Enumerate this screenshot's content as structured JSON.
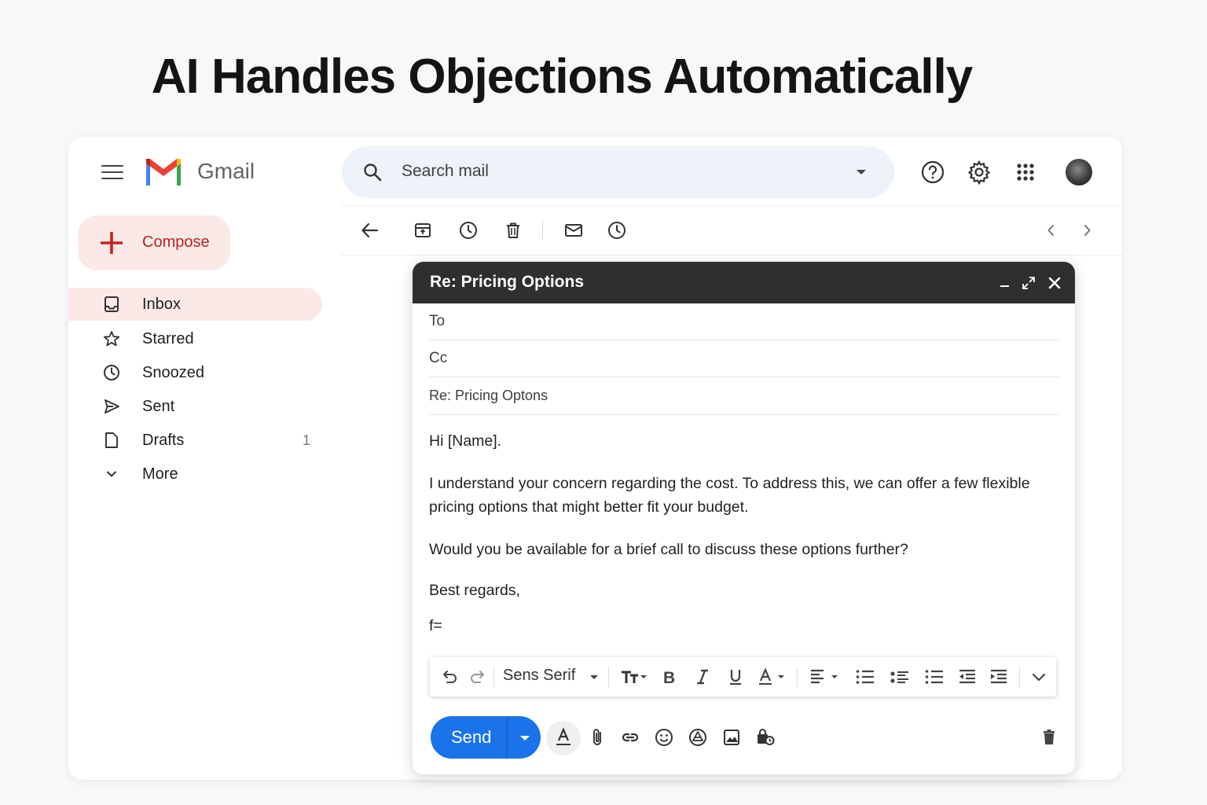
{
  "headline": "AI Handles Objections Automatically",
  "app": {
    "name": "Gmail"
  },
  "search": {
    "placeholder": "Search mail"
  },
  "compose": {
    "label": "Compose"
  },
  "nav": [
    {
      "label": "Inbox",
      "icon": "inbox-icon",
      "active": true
    },
    {
      "label": "Starred",
      "icon": "star-icon"
    },
    {
      "label": "Snoozed",
      "icon": "clock-icon"
    },
    {
      "label": "Sent",
      "icon": "send-icon"
    },
    {
      "label": "Drafts",
      "icon": "draft-icon",
      "count": "1"
    },
    {
      "label": "More",
      "icon": "chevron-down-icon"
    }
  ],
  "reply": {
    "window_title": "Re: Pricing Options",
    "to_label": "To",
    "cc_label": "Cc",
    "subject": "Re:  Pricing Optons",
    "body": {
      "greeting": "Hi [Name].",
      "paragraph1": "I understand your concern regarding the cost. To address this, we can offer a few flexible pricing options that might better fit your budget.",
      "paragraph2": "Would you be available for a brief call to discuss these options further?",
      "closing": "Best regards,",
      "signature": "f="
    },
    "font_name": "Sens Serif",
    "send_label": "Send"
  },
  "colors": {
    "accent_red": "#b3261e",
    "compose_bg": "#fbe9e8",
    "send_blue": "#1a73e8",
    "titlebar": "#2f2f2f"
  }
}
